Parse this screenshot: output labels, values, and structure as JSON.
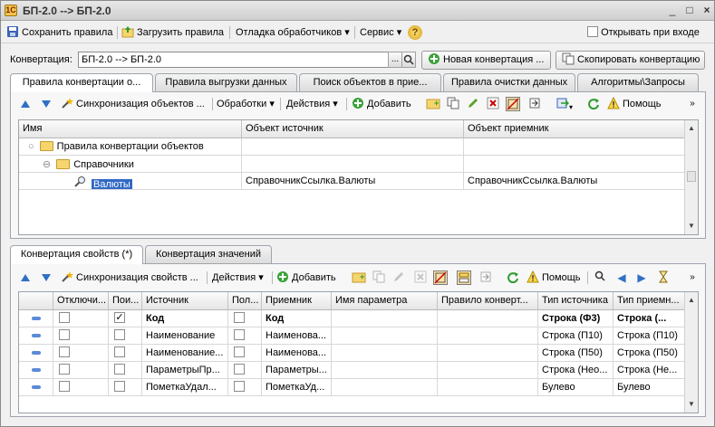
{
  "window": {
    "title": "БП-2.0 --> БП-2.0",
    "buttons": {
      "minimize": "_",
      "maximize": "□",
      "close": "×"
    }
  },
  "menubar": {
    "save": "Сохранить правила",
    "load": "Загрузить правила",
    "debug": "Отладка обработчиков",
    "service": "Сервис",
    "help_icon": "?",
    "open_at_login": "Открывать при входе"
  },
  "conversion": {
    "label": "Конвертация:",
    "value": "БП-2.0 --> БП-2.0",
    "new_button": "Новая конвертация ...",
    "copy_button": "Скопировать конвертацию"
  },
  "top_tabs": [
    {
      "label": "Правила конвертации о..."
    },
    {
      "label": "Правила выгрузки данных"
    },
    {
      "label": "Поиск объектов в прие..."
    },
    {
      "label": "Правила очистки данных"
    },
    {
      "label": "Алгоритмы\\Запросы"
    }
  ],
  "top_toolbar": {
    "sync": "Синхронизация объектов ...",
    "handlers": "Обработки",
    "actions": "Действия",
    "add": "Добавить",
    "help": "Помощь"
  },
  "top_grid": {
    "columns": [
      "Имя",
      "Объект источник",
      "Объект приемник"
    ],
    "rows": [
      {
        "name": "Правила конвертации объектов",
        "source": "",
        "target": "",
        "level": 0,
        "type": "folder"
      },
      {
        "name": "Справочники",
        "source": "",
        "target": "",
        "level": 1,
        "type": "folder"
      },
      {
        "name": "Валюты",
        "source": "СправочникСсылка.Валюты",
        "target": "СправочникСсылка.Валюты",
        "level": 2,
        "type": "item"
      }
    ]
  },
  "bottom_tabs": [
    {
      "label": "Конвертация свойств (*)"
    },
    {
      "label": "Конвертация значений"
    }
  ],
  "bottom_toolbar": {
    "sync": "Синхронизация свойств ...",
    "actions": "Действия",
    "add": "Добавить",
    "help": "Помощь"
  },
  "bottom_grid": {
    "columns": [
      "Отключи...",
      "Пои...",
      "Источник",
      "Пол...",
      "Приемник",
      "Имя параметра",
      "Правило конверт...",
      "Тип источника",
      "Тип приемн..."
    ],
    "rows": [
      {
        "disabled": false,
        "search": true,
        "source": "Код",
        "field": false,
        "target": "Код",
        "param": "",
        "rule": "",
        "source_type": "Строка (Ф3)",
        "target_type": "Строка (...",
        "bold": true
      },
      {
        "disabled": false,
        "search": false,
        "source": "Наименование",
        "field": false,
        "target": "Наименова...",
        "param": "",
        "rule": "",
        "source_type": "Строка (П10)",
        "target_type": "Строка (П10)",
        "bold": false
      },
      {
        "disabled": false,
        "search": false,
        "source": "Наименование...",
        "field": false,
        "target": "Наименова...",
        "param": "",
        "rule": "",
        "source_type": "Строка (П50)",
        "target_type": "Строка (П50)",
        "bold": false
      },
      {
        "disabled": false,
        "search": false,
        "source": "ПараметрыПр...",
        "field": false,
        "target": "Параметры...",
        "param": "",
        "rule": "",
        "source_type": "Строка (Нео...",
        "target_type": "Строка (Не...",
        "bold": false
      },
      {
        "disabled": false,
        "search": false,
        "source": "ПометкаУдал...",
        "field": false,
        "target": "ПометкаУд...",
        "param": "",
        "rule": "",
        "source_type": "Булево",
        "target_type": "Булево",
        "bold": false
      }
    ]
  }
}
